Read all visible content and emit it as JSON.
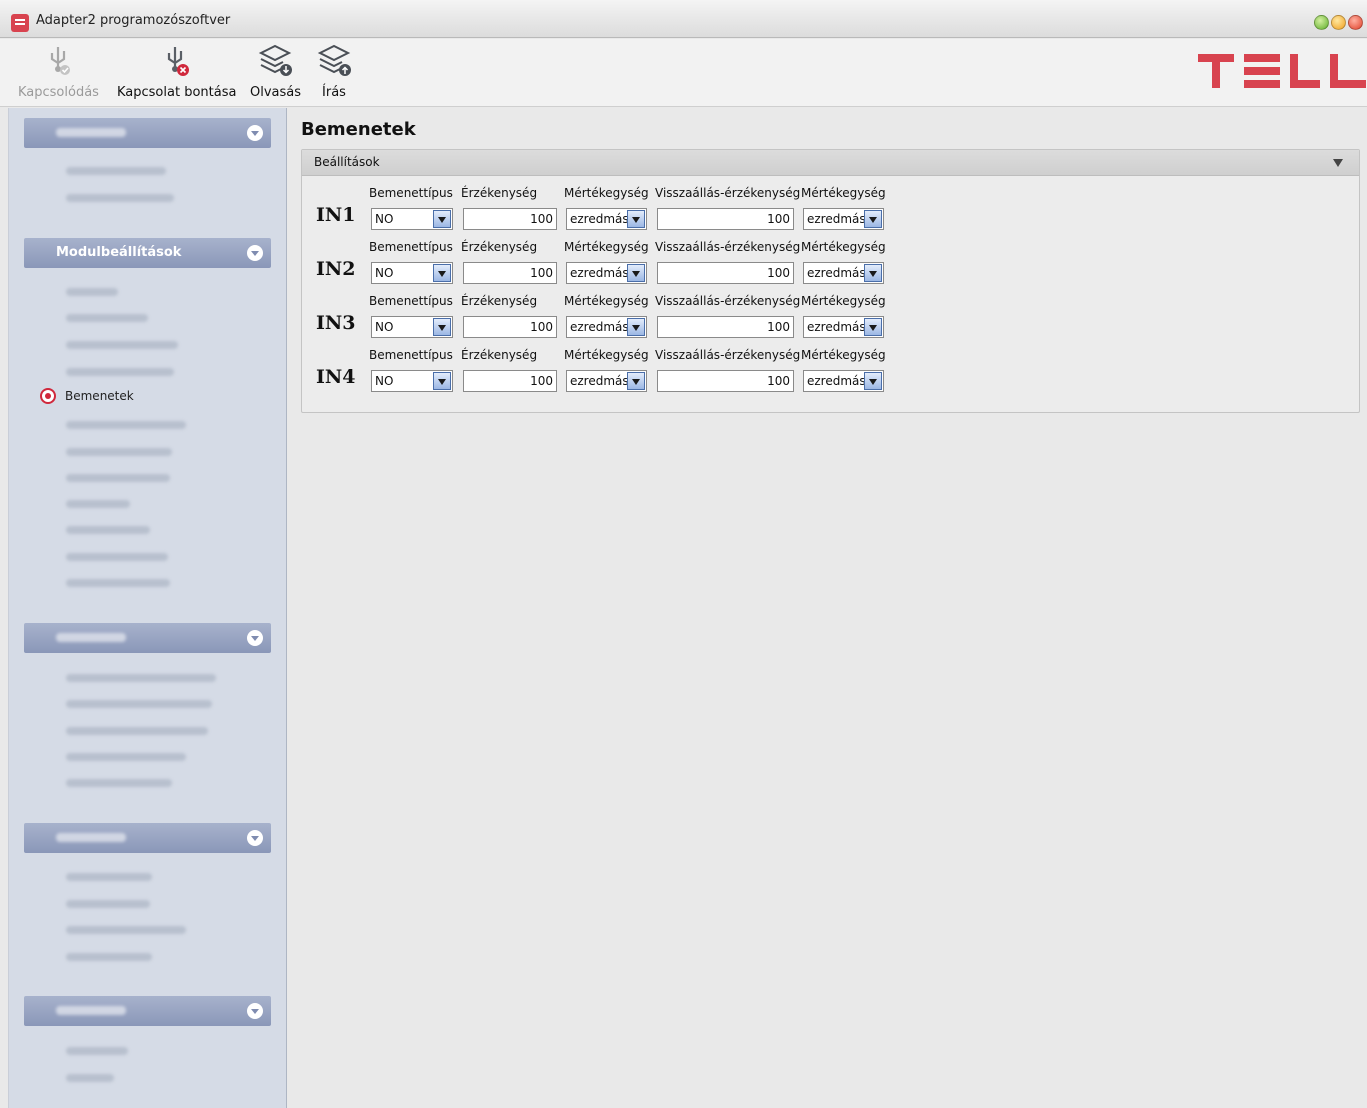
{
  "window": {
    "title": "Adapter2 programozószoftver"
  },
  "toolbar": {
    "connect_label": "Kapcsolódás",
    "disconnect_label": "Kapcsolat bontása",
    "read_label": "Olvasás",
    "write_label": "Írás"
  },
  "sidebar": {
    "module_settings_header": "Modulbeállítások",
    "active_item": "Bemenetek"
  },
  "main": {
    "title": "Bemenetek",
    "panel_title": "Beállítások",
    "columns": {
      "input_type": "Bemenettípus",
      "sensitivity": "Érzékenység",
      "unit": "Mértékegység",
      "restore_sensitivity": "Visszaállás-érzékenység",
      "restore_unit": "Mértékegység"
    },
    "inputs": [
      {
        "name": "IN1",
        "type": "NO",
        "sensitivity": "100",
        "unit": "ezredmás",
        "restore_sensitivity": "100",
        "restore_unit": "ezredmás"
      },
      {
        "name": "IN2",
        "type": "NO",
        "sensitivity": "100",
        "unit": "ezredmás",
        "restore_sensitivity": "100",
        "restore_unit": "ezredmás"
      },
      {
        "name": "IN3",
        "type": "NO",
        "sensitivity": "100",
        "unit": "ezredmás",
        "restore_sensitivity": "100",
        "restore_unit": "ezredmás"
      },
      {
        "name": "IN4",
        "type": "NO",
        "sensitivity": "100",
        "unit": "ezredmás",
        "restore_sensitivity": "100",
        "restore_unit": "ezredmás"
      }
    ]
  },
  "colors": {
    "accent_red": "#d0283c",
    "sidebar_header": "#8a97b8",
    "logo_red": "#d8434f"
  }
}
